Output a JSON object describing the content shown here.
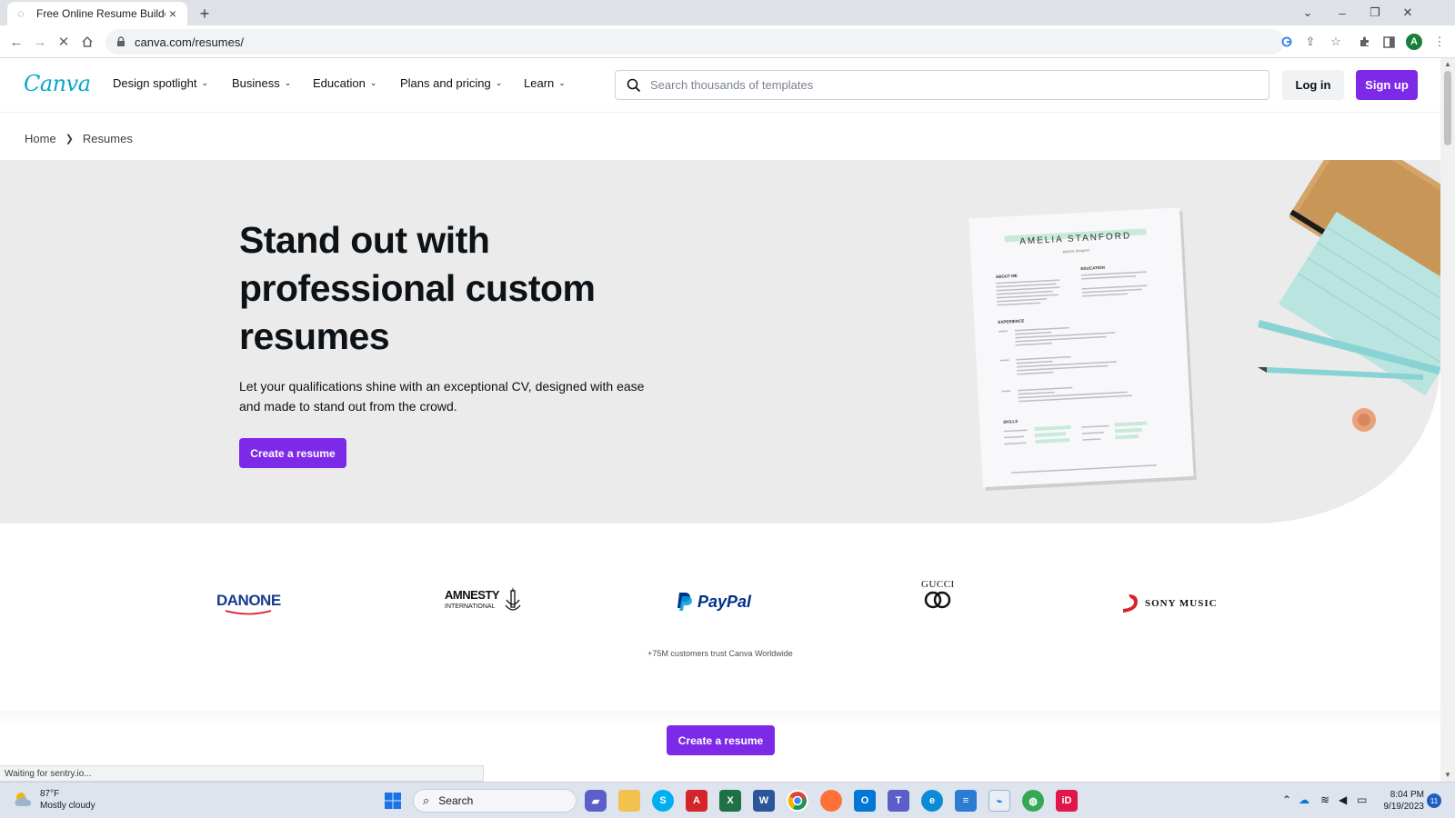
{
  "browser": {
    "tab_title": "Free Online Resume Builder | Eas",
    "new_tab": "+",
    "url": "canva.com/resumes/",
    "status_text": "Waiting for sentry.io..."
  },
  "site": {
    "logo": "Canva",
    "nav": [
      {
        "label": "Design spotlight"
      },
      {
        "label": "Business"
      },
      {
        "label": "Education"
      },
      {
        "label": "Plans and pricing"
      },
      {
        "label": "Learn"
      }
    ],
    "search_placeholder": "Search thousands of templates",
    "login_label": "Log in",
    "signup_label": "Sign up",
    "accent_color": "#7d2ae8"
  },
  "breadcrumb": {
    "home": "Home",
    "current": "Resumes"
  },
  "hero": {
    "title": "Stand out with professional custom resumes",
    "description": "Let your qualifications shine with an exceptional CV, designed with ease and made to stand out from the crowd.",
    "cta_label": "Create a resume",
    "resume_name": "AMELIA STANFORD",
    "resume_role": "graphic designer",
    "resume_sections": [
      "ABOUT ME",
      "EDUCATION",
      "EXPERIENCE",
      "SKILLS"
    ]
  },
  "brands": {
    "danone": "DANONE",
    "amnesty_1": "AMNESTY",
    "amnesty_2": "INTERNATIONAL",
    "paypal": "PayPal",
    "gucci": "GUCCI",
    "sony": "SONY MUSIC",
    "trust_text": "+75M customers trust Canva Worldwide"
  },
  "sticky_cta": "Create a resume",
  "taskbar": {
    "temperature": "87°F",
    "weather": "Mostly cloudy",
    "search_label": "Search",
    "time": "8:04 PM",
    "date": "9/19/2023",
    "notifications": "11"
  }
}
